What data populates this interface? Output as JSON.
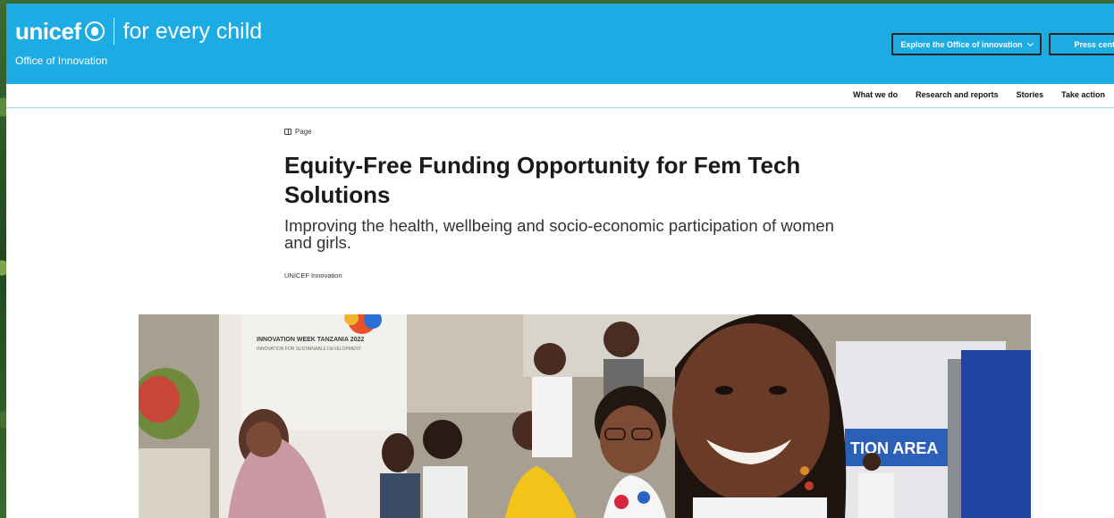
{
  "header": {
    "brand_name": "unicef",
    "tagline": "for every child",
    "office": "Office of Innovation",
    "explore_button": "Explore the Office of innovation",
    "press_button": "Press cent",
    "brand_color": "#1cabe2"
  },
  "subnav": {
    "items": [
      {
        "label": "What we do"
      },
      {
        "label": "Research and reports"
      },
      {
        "label": "Stories"
      },
      {
        "label": "Take action"
      }
    ]
  },
  "article": {
    "content_type": "Page",
    "title": "Equity-Free Funding Opportunity for Fem Tech Solutions",
    "subtitle": "Improving the health, wellbeing and socio-economic participation of women and girls.",
    "author": "UNICEF Innovation"
  },
  "hero_image": {
    "banner_text": "INNOVATION WEEK TANZANIA 2022",
    "banner_subtext": "INNOVATION FOR SUSTAINABLE DEVELOPMENT",
    "sign_text": "TION AREA"
  }
}
